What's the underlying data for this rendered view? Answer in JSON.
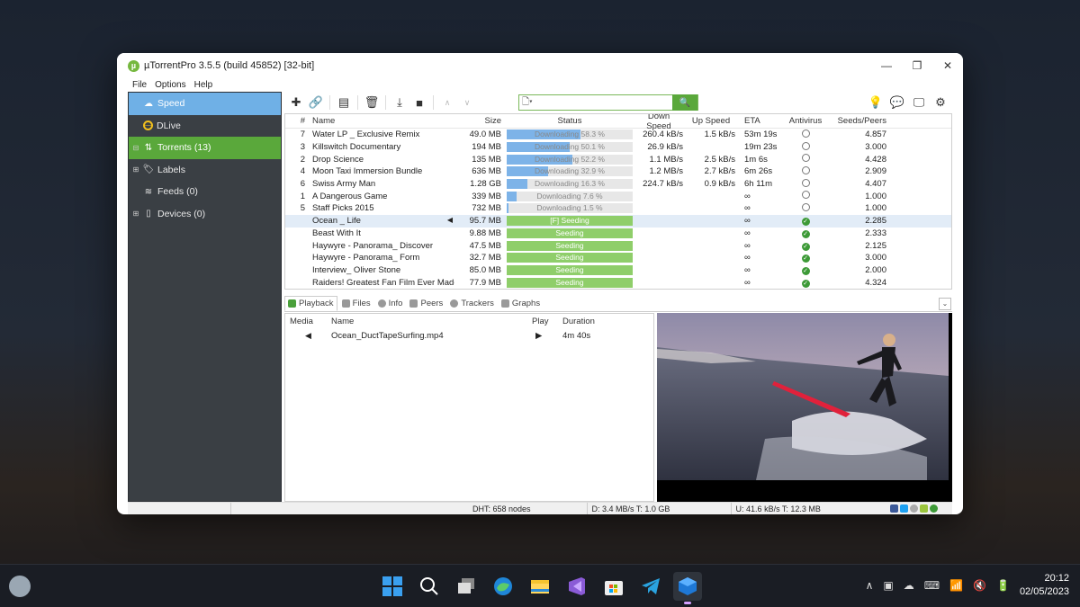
{
  "window": {
    "title": "µTorrentPro 3.5.5  (build 45852) [32-bit]",
    "menu": [
      "File",
      "Options",
      "Help"
    ]
  },
  "sidebar": {
    "items": [
      {
        "label": "Speed",
        "icon": "speed-icon",
        "expander": ""
      },
      {
        "label": "DLive",
        "icon": "dlive-icon",
        "expander": ""
      },
      {
        "label": "Torrents (13)",
        "icon": "torrents-icon",
        "expander": "⊟"
      },
      {
        "label": "Labels",
        "icon": "tag-icon",
        "expander": "⊞"
      },
      {
        "label": "Feeds (0)",
        "icon": "rss-icon",
        "expander": ""
      },
      {
        "label": "Devices (0)",
        "icon": "device-icon",
        "expander": "⊞"
      }
    ]
  },
  "search": {
    "placeholder": "",
    "value": ""
  },
  "list": {
    "headers": {
      "num": "#",
      "name": "Name",
      "size": "Size",
      "status": "Status",
      "down": "Down Speed",
      "up": "Up Speed",
      "eta": "ETA",
      "antivirus": "Antivirus",
      "seeds": "Seeds/Peers"
    },
    "rows": [
      {
        "num": "7",
        "name": "Water LP _ Exclusive Remix",
        "size": "49.0 MB",
        "status": "Downloading 58.3 %",
        "progress": 58.3,
        "seeding": false,
        "down": "260.4 kB/s",
        "up": "1.5 kB/s",
        "eta": "53m 19s",
        "av": "clock",
        "seeds": "4.857",
        "selected": false,
        "playing": false
      },
      {
        "num": "3",
        "name": "Killswitch Documentary",
        "size": "194 MB",
        "status": "Downloading 50.1 %",
        "progress": 50.1,
        "seeding": false,
        "down": "26.9 kB/s",
        "up": "",
        "eta": "19m 23s",
        "av": "clock",
        "seeds": "3.000",
        "selected": false,
        "playing": false
      },
      {
        "num": "2",
        "name": "Drop Science",
        "size": "135 MB",
        "status": "Downloading 52.2 %",
        "progress": 52.2,
        "seeding": false,
        "down": "1.1 MB/s",
        "up": "2.5 kB/s",
        "eta": "1m 6s",
        "av": "clock",
        "seeds": "4.428",
        "selected": false,
        "playing": false
      },
      {
        "num": "4",
        "name": "Moon Taxi Immersion Bundle",
        "size": "636 MB",
        "status": "Downloading 32.9 %",
        "progress": 32.9,
        "seeding": false,
        "down": "1.2 MB/s",
        "up": "2.7 kB/s",
        "eta": "6m 26s",
        "av": "clock",
        "seeds": "2.909",
        "selected": false,
        "playing": false
      },
      {
        "num": "6",
        "name": "Swiss Army Man",
        "size": "1.28 GB",
        "status": "Downloading 16.3 %",
        "progress": 16.3,
        "seeding": false,
        "down": "224.7 kB/s",
        "up": "0.9 kB/s",
        "eta": "6h 11m",
        "av": "clock",
        "seeds": "4.407",
        "selected": false,
        "playing": false
      },
      {
        "num": "1",
        "name": "A Dangerous Game",
        "size": "339 MB",
        "status": "Downloading 7.6 %",
        "progress": 7.6,
        "seeding": false,
        "down": "",
        "up": "",
        "eta": "∞",
        "av": "clock",
        "seeds": "1.000",
        "selected": false,
        "playing": false
      },
      {
        "num": "5",
        "name": "Staff Picks 2015",
        "size": "732 MB",
        "status": "Downloading 1.5 %",
        "progress": 1.5,
        "seeding": false,
        "down": "",
        "up": "",
        "eta": "∞",
        "av": "clock",
        "seeds": "1.000",
        "selected": false,
        "playing": false
      },
      {
        "num": "",
        "name": "Ocean _ Life",
        "size": "95.7 MB",
        "status": "[F] Seeding",
        "progress": 100,
        "seeding": true,
        "down": "",
        "up": "",
        "eta": "∞",
        "av": "check",
        "seeds": "2.285",
        "selected": true,
        "playing": true
      },
      {
        "num": "",
        "name": "Beast With It",
        "size": "9.88 MB",
        "status": "Seeding",
        "progress": 100,
        "seeding": true,
        "down": "",
        "up": "",
        "eta": "∞",
        "av": "check",
        "seeds": "2.333",
        "selected": false,
        "playing": false
      },
      {
        "num": "",
        "name": "Haywyre - Panorama_ Discover",
        "size": "47.5 MB",
        "status": "Seeding",
        "progress": 100,
        "seeding": true,
        "down": "",
        "up": "",
        "eta": "∞",
        "av": "check",
        "seeds": "2.125",
        "selected": false,
        "playing": false
      },
      {
        "num": "",
        "name": "Haywyre - Panorama_ Form",
        "size": "32.7 MB",
        "status": "Seeding",
        "progress": 100,
        "seeding": true,
        "down": "",
        "up": "",
        "eta": "∞",
        "av": "check",
        "seeds": "3.000",
        "selected": false,
        "playing": false
      },
      {
        "num": "",
        "name": "Interview_ Oliver Stone",
        "size": "85.0 MB",
        "status": "Seeding",
        "progress": 100,
        "seeding": true,
        "down": "",
        "up": "",
        "eta": "∞",
        "av": "check",
        "seeds": "2.000",
        "selected": false,
        "playing": false
      },
      {
        "num": "",
        "name": "Raiders! Greatest Fan Film Ever Made",
        "size": "77.9 MB",
        "status": "Seeding",
        "progress": 100,
        "seeding": true,
        "down": "",
        "up": "",
        "eta": "∞",
        "av": "check",
        "seeds": "4.324",
        "selected": false,
        "playing": false
      }
    ]
  },
  "tabs": [
    {
      "label": "Playback",
      "icon": "playback-icon",
      "active": true
    },
    {
      "label": "Files",
      "icon": "folder-icon",
      "active": false
    },
    {
      "label": "Info",
      "icon": "info-icon",
      "active": false
    },
    {
      "label": "Peers",
      "icon": "peers-icon",
      "active": false
    },
    {
      "label": "Trackers",
      "icon": "trackers-icon",
      "active": false
    },
    {
      "label": "Graphs",
      "icon": "graphs-icon",
      "active": false
    }
  ],
  "files": {
    "headers": {
      "media": "Media",
      "name": "Name",
      "play": "Play",
      "duration": "Duration"
    },
    "rows": [
      {
        "media": "◀",
        "name": "Ocean_DuctTapeSurfing.mp4",
        "play": "▶",
        "duration": "4m 40s"
      }
    ]
  },
  "statusbar": {
    "dht": "DHT: 658 nodes",
    "down": "D: 3.4 MB/s T: 1.0 GB",
    "up": "U: 41.6 kB/s T: 12.3 MB"
  },
  "taskbar": {
    "time": "20:12",
    "date": "02/05/2023",
    "apps": [
      "windows-start-icon",
      "search-icon",
      "task-view-icon",
      "edge-icon",
      "file-explorer-icon",
      "visual-studio-icon",
      "store-icon",
      "telegram-icon",
      "app-cube-icon"
    ]
  },
  "colors": {
    "accent_green": "#5aa83b",
    "speed_blue": "#6fb0e6",
    "progress_blue": "#7db3e8",
    "seeding_green": "#8fce6a"
  }
}
